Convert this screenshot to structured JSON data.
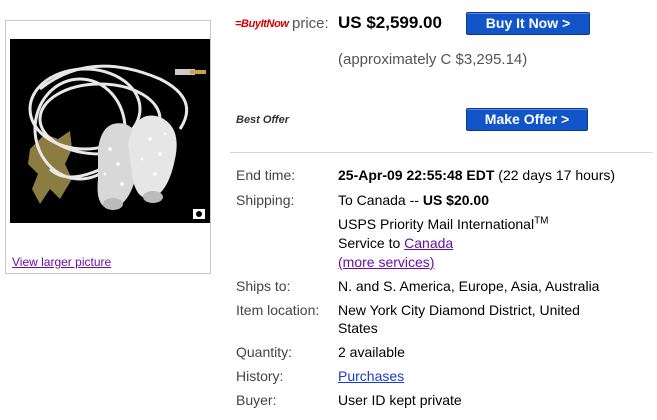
{
  "image_box": {
    "view_larger_label": "View larger picture"
  },
  "buy_it_now": {
    "logo_text_part1": "=Buy",
    "logo_text_part2": "It",
    "logo_text_part3": "Now",
    "price_label": "price:",
    "price_value": "US $2,599.00",
    "button_label": "Buy It Now >",
    "approx_price": "(approximately C $3,295.14)"
  },
  "best_offer": {
    "label": "Best Offer",
    "button_label": "Make Offer >"
  },
  "details": {
    "end_time_label": "End time:",
    "end_time_value": "25-Apr-09 22:55:48 EDT",
    "end_time_remaining": "(22 days 17 hours)",
    "shipping_label": "Shipping:",
    "shipping_dest": "To Canada -- ",
    "shipping_cost": "US $20.00",
    "shipping_service": "USPS Priority Mail International",
    "shipping_service_tm": "TM",
    "service_to_text": "Service to ",
    "service_to_link": "Canada",
    "more_services": "(more services)",
    "ships_to_label": "Ships to:",
    "ships_to_value": "N. and S. America, Europe, Asia, Australia",
    "location_label": "Item location:",
    "location_line1": "New York City Diamond District, United",
    "location_line2": "States",
    "quantity_label": "Quantity:",
    "quantity_value": "2 available",
    "history_label": "History:",
    "history_value": "Purchases",
    "buyer_label": "Buyer:",
    "buyer_value": "User ID kept private"
  },
  "colors": {
    "button_blue": "#1255c8",
    "link_purple": "#6a0fa0",
    "link_blue": "#1a3ac8",
    "buy_it_now_red": "#d40000"
  }
}
